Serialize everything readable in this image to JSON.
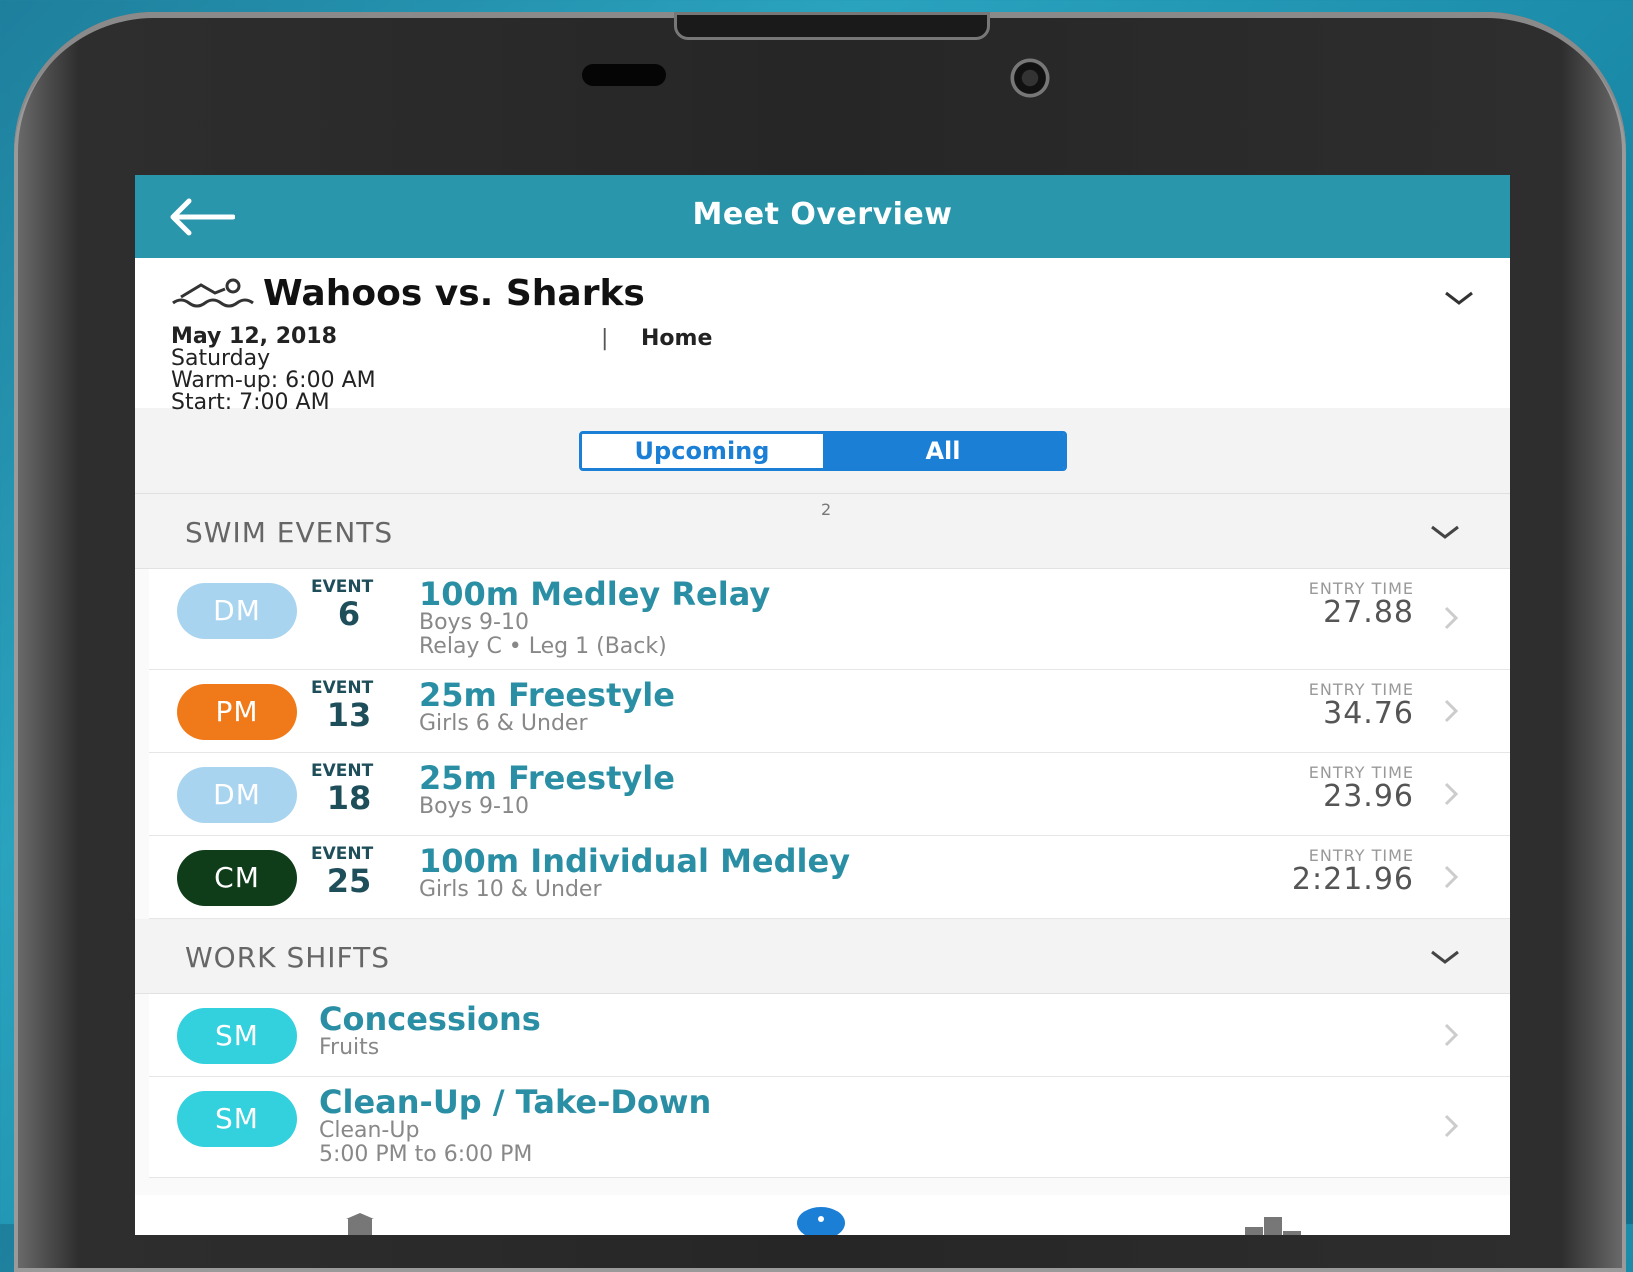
{
  "app_bar": {
    "title": "Meet Overview"
  },
  "meet": {
    "title": "Wahoos vs. Sharks",
    "date": "May 12, 2018",
    "day": "Saturday",
    "warmup": "Warm-up: 6:00 AM",
    "start": "Start: 7:00 AM",
    "separator": "|",
    "location": "Home"
  },
  "filter": {
    "upcoming_label": "Upcoming",
    "all_label": "All",
    "selected": "All"
  },
  "swim_events": {
    "label": "SWIM EVENTS",
    "count": "2",
    "items": [
      {
        "avatar": "DM",
        "avatar_color": "#a9d4f0",
        "event_label": "EVENT",
        "event_number": "6",
        "title": "100m Medley Relay",
        "subtitle": "Boys 9-10",
        "subtitle2": "Relay C • Leg 1 (Back)",
        "entry_label": "ENTRY TIME",
        "entry_time": "27.88"
      },
      {
        "avatar": "PM",
        "avatar_color": "#f07a1a",
        "event_label": "EVENT",
        "event_number": "13",
        "title": "25m Freestyle",
        "subtitle": "Girls 6 & Under",
        "entry_label": "ENTRY TIME",
        "entry_time": "34.76"
      },
      {
        "avatar": "DM",
        "avatar_color": "#a9d4f0",
        "event_label": "EVENT",
        "event_number": "18",
        "title": "25m Freestyle",
        "subtitle": "Boys 9-10",
        "entry_label": "ENTRY TIME",
        "entry_time": "23.96"
      },
      {
        "avatar": "CM",
        "avatar_color": "#0f3d1a",
        "event_label": "EVENT",
        "event_number": "25",
        "title": "100m Individual Medley",
        "subtitle": "Girls 10 & Under",
        "entry_label": "ENTRY TIME",
        "entry_time": "2:21.96"
      }
    ]
  },
  "work_shifts": {
    "label": "WORK SHIFTS",
    "items": [
      {
        "avatar": "SM",
        "avatar_color": "#33d0dd",
        "title": "Concessions",
        "subtitle": "Fruits"
      },
      {
        "avatar": "SM",
        "avatar_color": "#33d0dd",
        "title": "Clean-Up / Take-Down",
        "subtitle": "Clean-Up",
        "subtitle2": "5:00 PM to 6:00 PM"
      }
    ]
  },
  "icons": {
    "back": "arrow-left-icon",
    "expand": "chevron-down-icon",
    "row": "chevron-right-icon",
    "swimmer": "swimmer-icon"
  },
  "colors": {
    "app_bar": "#2a96ab",
    "segment_accent": "#1b7fd6",
    "title_text": "#2a8fa4"
  }
}
